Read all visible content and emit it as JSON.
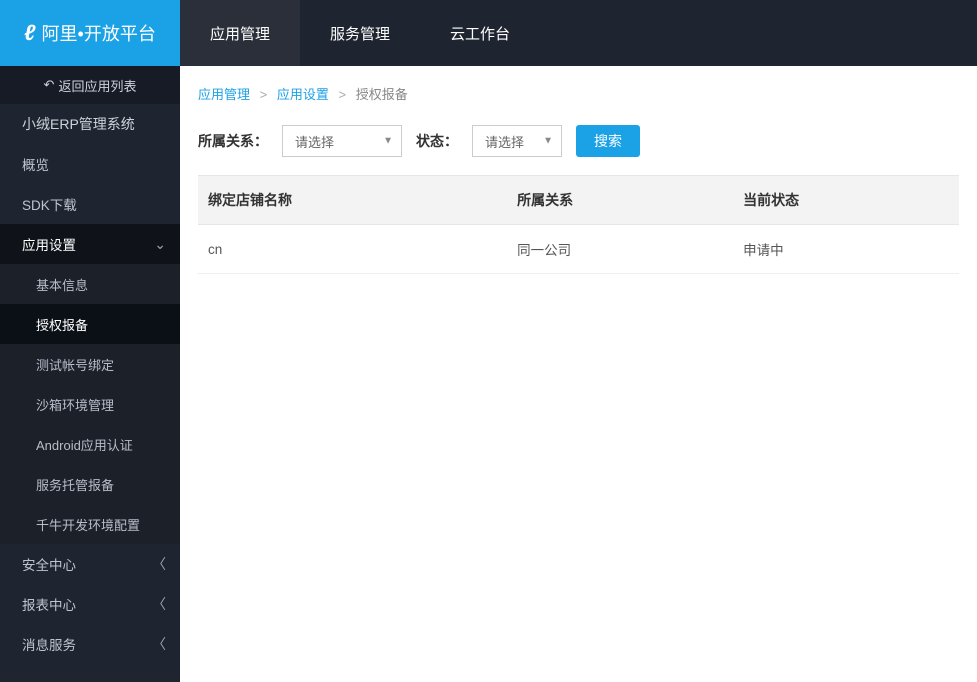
{
  "logo": {
    "text": "阿里•开放平台"
  },
  "topnav": [
    {
      "label": "应用管理",
      "active": true
    },
    {
      "label": "服务管理",
      "active": false
    },
    {
      "label": "云工作台",
      "active": false
    }
  ],
  "sidebar": {
    "back": "返回应用列表",
    "title": "小绒ERP管理系统",
    "items": [
      {
        "label": "概览"
      },
      {
        "label": "SDK下载"
      },
      {
        "label": "应用设置",
        "expanded": true,
        "children": [
          {
            "label": "基本信息"
          },
          {
            "label": "授权报备",
            "active": true
          },
          {
            "label": "测试帐号绑定"
          },
          {
            "label": "沙箱环境管理"
          },
          {
            "label": "Android应用认证"
          },
          {
            "label": "服务托管报备"
          },
          {
            "label": "千牛开发环境配置"
          }
        ]
      },
      {
        "label": "安全中心",
        "chevron": true
      },
      {
        "label": "报表中心",
        "chevron": true
      },
      {
        "label": "消息服务",
        "chevron": true
      }
    ]
  },
  "breadcrumb": {
    "a": "应用管理",
    "b": "应用设置",
    "c": "授权报备"
  },
  "filters": {
    "relation_label": "所属关系：",
    "relation_placeholder": "请选择",
    "status_label": "状态：",
    "status_placeholder": "请选择",
    "search_label": "搜索"
  },
  "table": {
    "headers": {
      "shop": "绑定店铺名称",
      "relation": "所属关系",
      "status": "当前状态"
    },
    "rows": [
      {
        "shop": "cn",
        "relation": "同一公司",
        "status": "申请中"
      }
    ]
  }
}
